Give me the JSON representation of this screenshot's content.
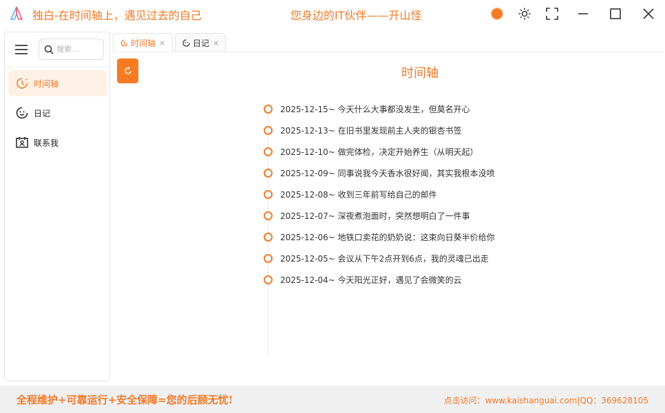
{
  "window": {
    "app_title": "独白-在时间轴上，遇见过去的自己",
    "slogan": "您身边的IT伙伴——开山怪",
    "theme_color": "#f77b22"
  },
  "sidebar": {
    "search_placeholder": "搜索...",
    "items": [
      {
        "label": "时间轴",
        "icon": "clock-icon",
        "active": true
      },
      {
        "label": "日记",
        "icon": "smiley-icon",
        "active": false
      },
      {
        "label": "联系我",
        "icon": "contact-card-icon",
        "active": false
      }
    ]
  },
  "tabs": [
    {
      "label": "时间轴",
      "icon": "clock-icon",
      "active": true,
      "close": "×"
    },
    {
      "label": "日记",
      "icon": "smiley-icon",
      "active": false,
      "close": "×"
    }
  ],
  "main": {
    "title": "时间轴",
    "entries": [
      "2025-12-15~ 今天什么大事都没发生，但莫名开心",
      "2025-12-13~ 在旧书里发现前主人夹的银杏书签",
      "2025-12-10~ 做完体检，决定开始养生（从明天起）",
      "2025-12-09~ 同事说我今天香水很好闻，其实我根本没喷",
      "2025-12-08~ 收到三年前写给自己的邮件",
      "2025-12-07~ 深夜煮泡面时，突然想明白了一件事",
      "2025-12-06~ 地铁口卖花的奶奶说：这束向日葵半价给你",
      "2025-12-05~ 会议从下午2点开到6点，我的灵魂已出走",
      "2025-12-04~ 今天阳光正好，遇见了会微笑的云"
    ]
  },
  "footer": {
    "left": "全程维护+可靠运行+安全保障=您的后顾无忧!",
    "right": "点击访问：www.kaishanguai.com|QQ：369628105"
  },
  "colors": {
    "accent": "#ef7a2a",
    "active_bg": "#fdf1e6"
  }
}
